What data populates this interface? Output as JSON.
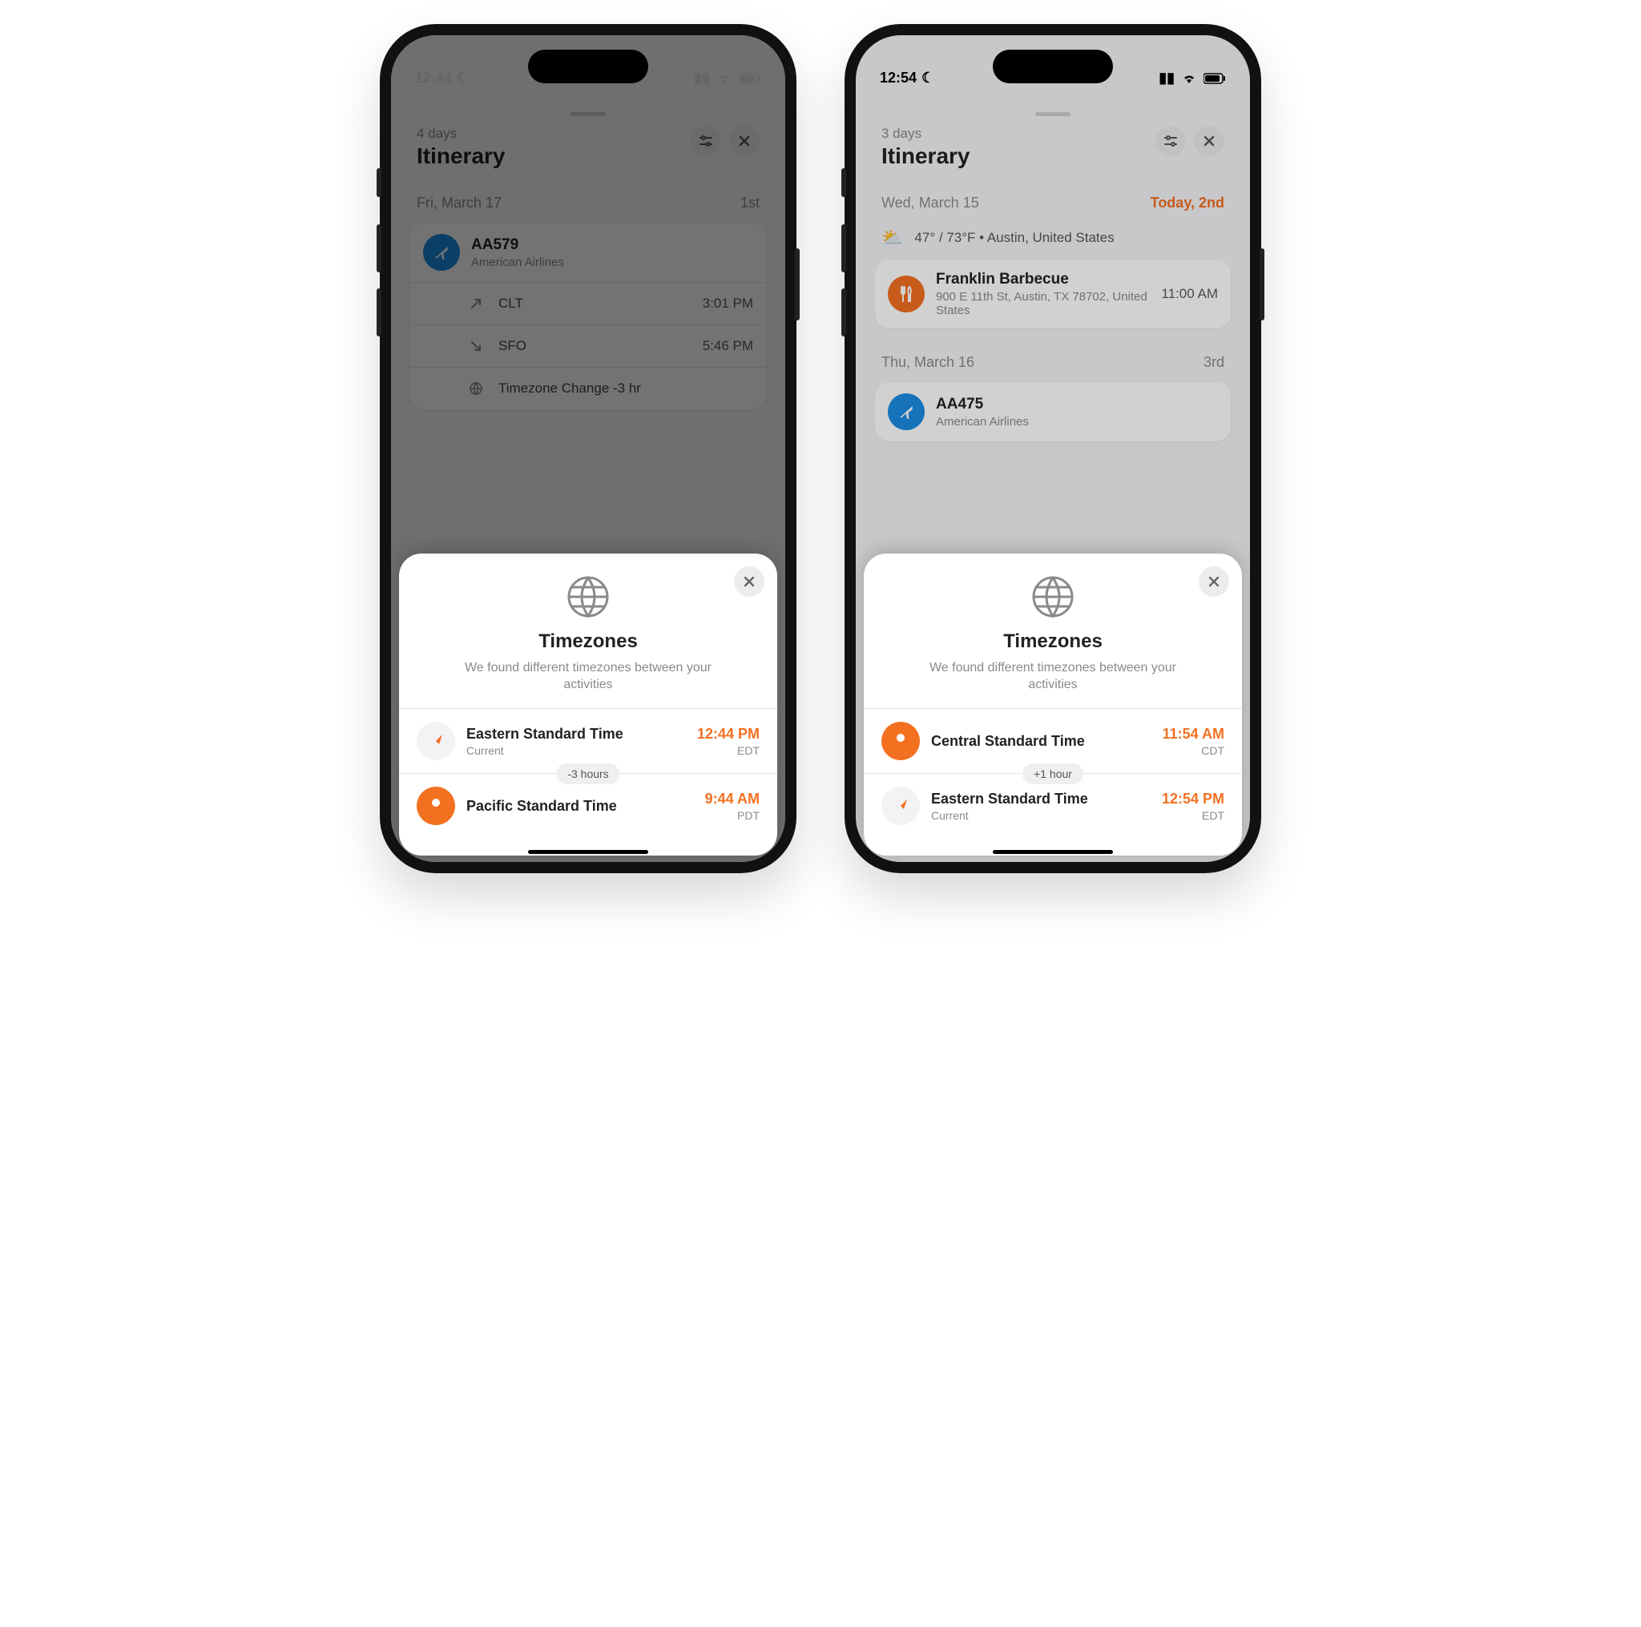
{
  "phones": [
    {
      "status": {
        "time": "12:44",
        "dnd": true
      },
      "sheet": {
        "days_label": "4 days",
        "title": "Itinerary"
      },
      "day": {
        "label": "Fri, March 17",
        "ordinal": "1st",
        "highlight": false
      },
      "flight": {
        "code": "AA579",
        "airline": "American Airlines",
        "dep": {
          "code": "CLT",
          "time": "3:01 PM"
        },
        "arr": {
          "code": "SFO",
          "time": "5:46 PM"
        },
        "tz_change": "Timezone Change -3 hr"
      },
      "modal": {
        "title": "Timezones",
        "sub": "We found different timezones between your activities",
        "delta": "-3 hours",
        "rows": [
          {
            "icon": "compass",
            "name": "Eastern Standard Time",
            "current": "Current",
            "time": "12:44 PM",
            "abbr": "EDT"
          },
          {
            "icon": "pin",
            "name": "Pacific Standard Time",
            "current": "",
            "time": "9:44 AM",
            "abbr": "PDT"
          }
        ]
      }
    },
    {
      "status": {
        "time": "12:54",
        "dnd": true
      },
      "sheet": {
        "days_label": "3 days",
        "title": "Itinerary"
      },
      "day": {
        "label": "Wed, March 15",
        "ordinal": "Today, 2nd",
        "highlight": true
      },
      "weather": {
        "text": "47° / 73°F • Austin, United States"
      },
      "poi": {
        "name": "Franklin Barbecue",
        "addr": "900 E 11th St, Austin, TX  78702, United States",
        "time": "11:00 AM"
      },
      "day2": {
        "label": "Thu, March 16",
        "ordinal": "3rd"
      },
      "flight2": {
        "code": "AA475",
        "airline": "American Airlines"
      },
      "modal": {
        "title": "Timezones",
        "sub": "We found different timezones between your activities",
        "delta": "+1 hour",
        "rows": [
          {
            "icon": "pin",
            "name": "Central Standard Time",
            "current": "",
            "time": "11:54 AM",
            "abbr": "CDT"
          },
          {
            "icon": "compass",
            "name": "Eastern Standard Time",
            "current": "Current",
            "time": "12:54 PM",
            "abbr": "EDT"
          }
        ]
      }
    }
  ]
}
